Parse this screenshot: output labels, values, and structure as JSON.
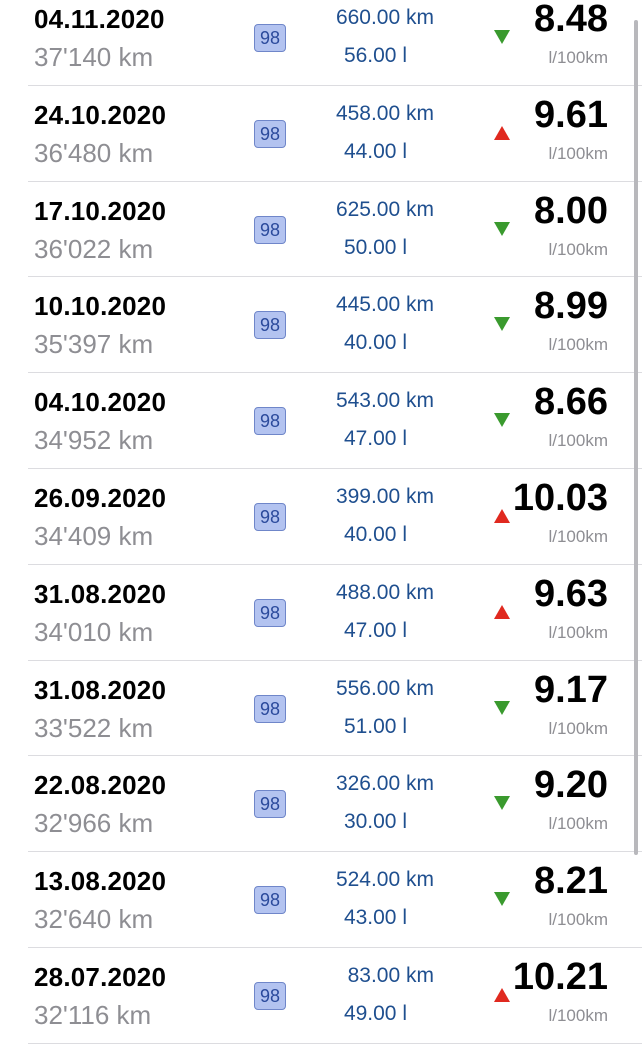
{
  "entries": [
    {
      "date": "04.11.2020",
      "odometer": "37'140 km",
      "fuel": "98",
      "distance": "660.00 km",
      "volume": "56.00 l",
      "trend": "down",
      "consumption": "8.48",
      "unit": "l/100km"
    },
    {
      "date": "24.10.2020",
      "odometer": "36'480 km",
      "fuel": "98",
      "distance": "458.00 km",
      "volume": "44.00 l",
      "trend": "up",
      "consumption": "9.61",
      "unit": "l/100km"
    },
    {
      "date": "17.10.2020",
      "odometer": "36'022 km",
      "fuel": "98",
      "distance": "625.00 km",
      "volume": "50.00 l",
      "trend": "down",
      "consumption": "8.00",
      "unit": "l/100km"
    },
    {
      "date": "10.10.2020",
      "odometer": "35'397 km",
      "fuel": "98",
      "distance": "445.00 km",
      "volume": "40.00 l",
      "trend": "down",
      "consumption": "8.99",
      "unit": "l/100km"
    },
    {
      "date": "04.10.2020",
      "odometer": "34'952 km",
      "fuel": "98",
      "distance": "543.00 km",
      "volume": "47.00 l",
      "trend": "down",
      "consumption": "8.66",
      "unit": "l/100km"
    },
    {
      "date": "26.09.2020",
      "odometer": "34'409 km",
      "fuel": "98",
      "distance": "399.00 km",
      "volume": "40.00 l",
      "trend": "up",
      "consumption": "10.03",
      "unit": "l/100km"
    },
    {
      "date": "31.08.2020",
      "odometer": "34'010 km",
      "fuel": "98",
      "distance": "488.00 km",
      "volume": "47.00 l",
      "trend": "up",
      "consumption": "9.63",
      "unit": "l/100km"
    },
    {
      "date": "31.08.2020",
      "odometer": "33'522 km",
      "fuel": "98",
      "distance": "556.00 km",
      "volume": "51.00 l",
      "trend": "down",
      "consumption": "9.17",
      "unit": "l/100km"
    },
    {
      "date": "22.08.2020",
      "odometer": "32'966 km",
      "fuel": "98",
      "distance": "326.00 km",
      "volume": "30.00 l",
      "trend": "down",
      "consumption": "9.20",
      "unit": "l/100km"
    },
    {
      "date": "13.08.2020",
      "odometer": "32'640 km",
      "fuel": "98",
      "distance": "524.00 km",
      "volume": "43.00 l",
      "trend": "down",
      "consumption": "8.21",
      "unit": "l/100km"
    },
    {
      "date": "28.07.2020",
      "odometer": "32'116 km",
      "fuel": "98",
      "distance": "83.00 km",
      "volume": "49.00 l",
      "trend": "up",
      "consumption": "10.21",
      "unit": "l/100km"
    }
  ],
  "colors": {
    "trend_down": "#3a9a2e",
    "trend_up": "#e0291f",
    "value_blue": "#1f4f8f",
    "badge_fill": "#b3c3f0"
  }
}
